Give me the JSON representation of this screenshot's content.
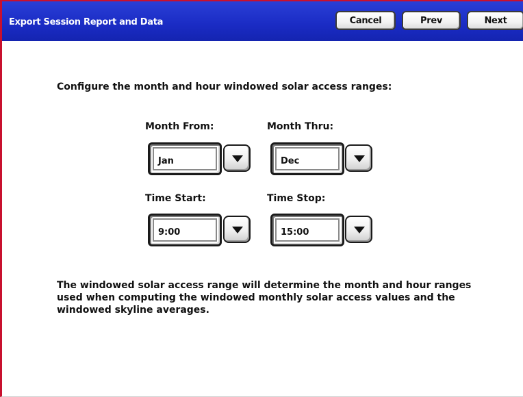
{
  "header": {
    "title": "Export Session Report and Data",
    "cancel_label": "Cancel",
    "prev_label": "Prev",
    "next_label": "Next"
  },
  "main": {
    "instruction": "Configure the month and hour windowed solar access ranges:",
    "month_from": {
      "label": "Month From:",
      "value": "Jan"
    },
    "month_thru": {
      "label": "Month Thru:",
      "value": "Dec"
    },
    "time_start": {
      "label": "Time Start:",
      "value": "9:00"
    },
    "time_stop": {
      "label": "Time Stop:",
      "value": "15:00"
    },
    "description": "The windowed solar access range will determine the month and hour ranges used when computing the windowed monthly solar access values and the windowed skyline averages."
  },
  "icons": {
    "dropdown": "triangle-down-icon"
  },
  "colors": {
    "titlebar": "#1a2bc4",
    "border_accent": "#c8102e",
    "text": "#111111"
  }
}
